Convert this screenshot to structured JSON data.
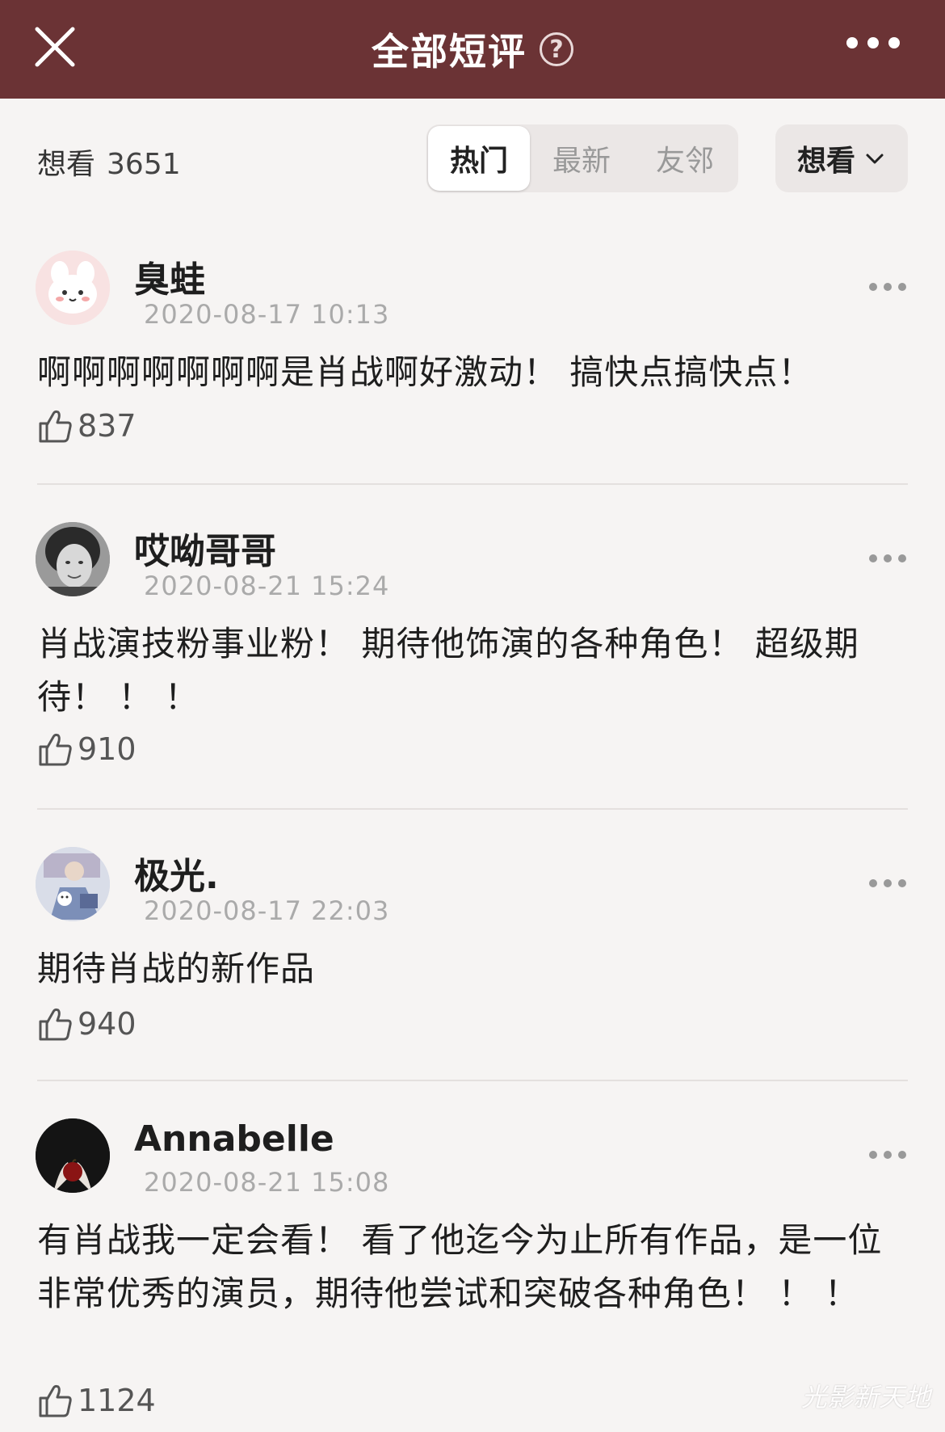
{
  "header": {
    "title": "全部短评",
    "help_symbol": "?",
    "close_icon": "close-icon",
    "more_icon": "more-horizontal-icon",
    "background_color": "#6b3335"
  },
  "filter_bar": {
    "want_label": "想看",
    "want_count": "3651",
    "tabs": [
      {
        "label": "热门",
        "active": true
      },
      {
        "label": "最新",
        "active": false
      },
      {
        "label": "友邻",
        "active": false
      }
    ],
    "dropdown": {
      "label": "想看",
      "icon": "chevron-down-icon"
    }
  },
  "comments": [
    {
      "username": "臭蛙",
      "time": "2020-08-17 10:13",
      "text": "啊啊啊啊啊啊啊是肖战啊好激动！ 搞快点搞快点！",
      "likes": "837",
      "avatar": "bunny-avatar"
    },
    {
      "username": "哎呦哥哥",
      "time": "2020-08-21 15:24",
      "text": "肖战演技粉事业粉！ 期待他饰演的各种角色！ 超级期待！ ！ ！",
      "likes": "910",
      "avatar": "portrait-avatar"
    },
    {
      "username": "极光.",
      "time": "2020-08-17 22:03",
      "text": "期待肖战的新作品",
      "likes": "940",
      "avatar": "illustration-avatar"
    },
    {
      "username": "Annabelle",
      "time": "2020-08-21 15:08",
      "text": "有肖战我一定会看！ 看了他迄今为止所有作品，是一位非常优秀的演员，期待他尝试和突破各种角色！ ！ ！",
      "likes": "1124",
      "avatar": "twilight-apple-avatar"
    }
  ],
  "watermark": "光影新天地"
}
